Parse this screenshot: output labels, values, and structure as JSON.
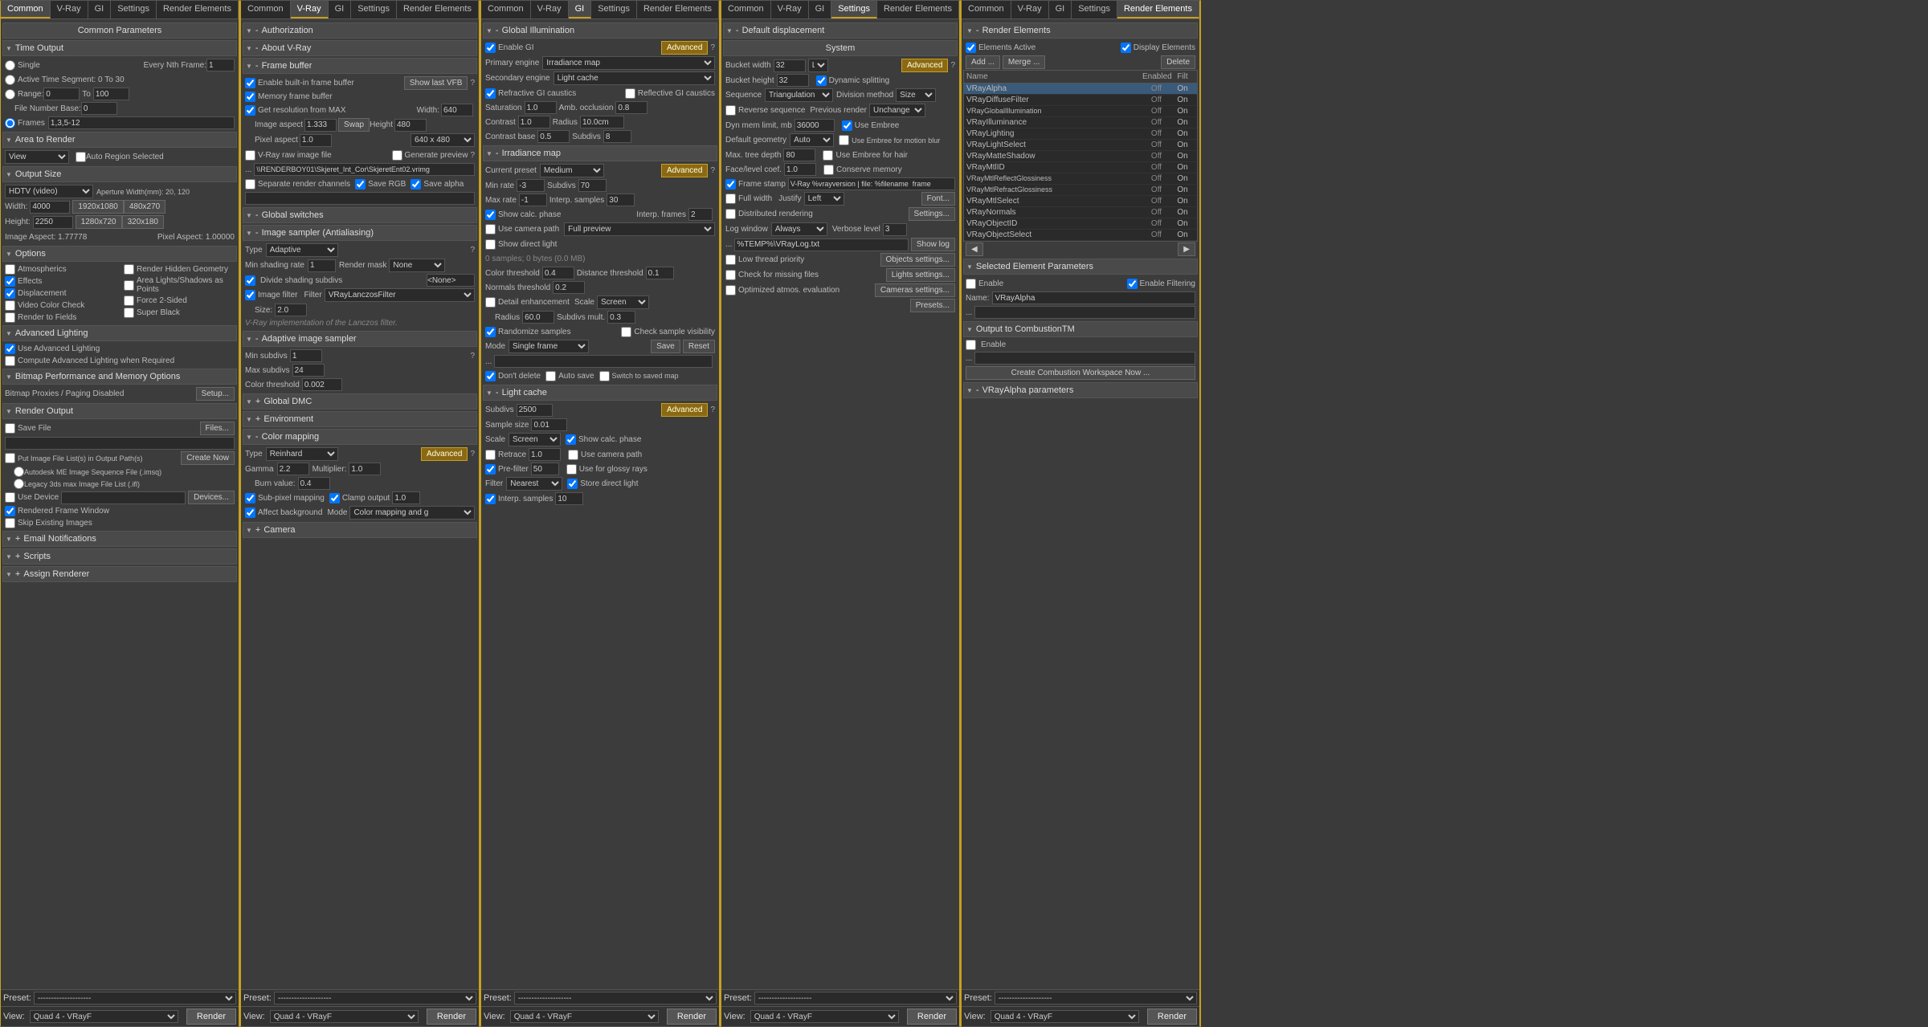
{
  "panels": [
    {
      "id": "panel1",
      "tabs": [
        "Common",
        "V-Ray",
        "GI",
        "Settings",
        "Render Elements"
      ],
      "activeTab": "Common",
      "title": "Common Parameters",
      "sections": {
        "timeOutput": {
          "label": "Time Output",
          "single": "Single",
          "everyNthFrame": "Every Nth Frame:",
          "activeTimeSegment": "Active Time Segment:",
          "range0": "0",
          "rangeTo": "To",
          "range100": "100",
          "fileNumberBase": "File Number Base:",
          "frames": "Frames",
          "framesVal": "1,3,5-12"
        },
        "areaToRender": {
          "label": "Area to Render",
          "view": "View",
          "autoRegionSelected": "Auto Region Selected"
        },
        "outputSize": {
          "label": "Output Size",
          "preset": "HDTV (video)",
          "apertureWidth": "Aperture Width(mm): 20, 120",
          "width": "Width:",
          "widthVal": "4000",
          "res1": "1920x1080",
          "res2": "480x270",
          "height": "Height:",
          "heightVal": "2250",
          "res3": "1280x720",
          "res4": "320x180",
          "imageAspect": "Image Aspect: 1.77778",
          "pixelAspect": "Pixel Aspect: 1.00000"
        },
        "options": {
          "label": "Options",
          "atmospherics": "Atmospherics",
          "renderHiddenGeometry": "Render Hidden Geometry",
          "effects": "Effects",
          "areaLights": "Area Lights/Shadows as Points",
          "displacement": "Displacement",
          "force2Sided": "Force 2-Sided",
          "videoColorCheck": "Video Color Check",
          "superBlack": "Super Black",
          "renderToFields": "Render to Fields"
        },
        "advancedLighting": {
          "label": "Advanced Lighting",
          "useAdvancedLighting": "Use Advanced Lighting",
          "computeAdvancedLighting": "Compute Advanced Lighting when Required"
        },
        "bitmapPerformance": {
          "label": "Bitmap Performance and Memory Options",
          "bitmapProxies": "Bitmap Proxies / Paging Disabled",
          "setup": "Setup..."
        },
        "renderOutput": {
          "label": "Render Output",
          "saveFile": "Save File",
          "files": "Files...",
          "putImageFile": "Put Image File List(s) in Output Path(s)",
          "createNow": "Create Now",
          "autodesk": "Autodesk ME Image Sequence File (.imsq)",
          "legacy": "Legacy 3ds max Image File List (.ifl)",
          "useDevice": "Use Device",
          "devices": "Devices...",
          "renderedFrameWindow": "Rendered Frame Window",
          "skipExistingImages": "Skip Existing Images"
        },
        "emailNotifications": "Email Notifications",
        "scripts": "Scripts",
        "assignRenderer": "Assign Renderer"
      }
    },
    {
      "id": "panel2",
      "tabs": [
        "Common",
        "V-Ray",
        "GI",
        "Settings",
        "Render Elements"
      ],
      "activeTab": "V-Ray",
      "sections": {
        "authorization": "Authorization",
        "aboutVRay": "About V-Ray",
        "frameBuffer": {
          "label": "Frame buffer",
          "enableBuiltIn": "Enable built-in frame buffer",
          "showLastVFB": "Show last VFB",
          "memoryFrameBuffer": "Memory frame buffer"
        },
        "getResFromMax": {
          "label": "Get resolution from MAX",
          "swap": "Swap",
          "width": "Width:",
          "widthVal": "640",
          "imageAspect": "Image aspect",
          "imageAspectVal": "1.333",
          "heightLabel": "Height",
          "heightVal": "480",
          "pixelAspect": "Pixel aspect",
          "pixelAspectVal": "1.0",
          "preset": "640 x 480"
        },
        "rawImageFile": {
          "vrayRaw": "V-Ray raw image file",
          "generatePreview": "Generate preview",
          "path": "\\\\RENDERBOY01\\Skjeret_Int_Cor\\SkjeretEnt02.vrimg",
          "separateRenderChannels": "Separate render channels",
          "saveRGB": "Save RGB",
          "saveAlpha": "Save alpha"
        },
        "globalSwitches": "Global switches",
        "imageSampler": {
          "label": "Image sampler (Antialiasing)",
          "type": "Type",
          "typeVal": "Adaptive",
          "minShadingRate": "Min shading rate",
          "minShadingRateVal": "1",
          "renderMask": "Render mask",
          "renderMaskVal": "None",
          "divideShadingSubdivs": "Divide shading subdivs",
          "noneVal": "<None>"
        },
        "imageFilter": {
          "imageFilter": "Image filter",
          "filter": "Filter",
          "filterVal": "VRayLanczosFilter",
          "size": "Size:",
          "sizeVal": "2.0",
          "description": "V-Ray implementation of the Lanczos filter."
        },
        "adaptiveImageSampler": {
          "label": "Adaptive image sampler",
          "minSubdivs": "Min subdivs",
          "minSubdivsVal": "1",
          "maxSubdivs": "Max subdivs",
          "maxSubdivsVal": "24",
          "colorThreshold": "Color threshold",
          "colorThresholdVal": "0.002"
        },
        "globalDMC": "Global DMC",
        "environment": "Environment",
        "colorMapping": {
          "label": "Color mapping",
          "type": "Type",
          "typeVal": "Reinhard",
          "advanced": "Advanced",
          "gamma": "Gamma",
          "gammaVal": "2.2",
          "multiplier": "Multiplier:",
          "multiplierVal": "1.0",
          "burnValue": "Burn value:",
          "burnValueVal": "0.4",
          "subPixelMapping": "Sub-pixel mapping",
          "clampOutput": "Clamp output",
          "clampVal": "1.0",
          "affectBackground": "Affect background",
          "mode": "Mode",
          "modeVal": "Color mapping and g"
        },
        "camera": "Camera"
      }
    },
    {
      "id": "panel3",
      "tabs": [
        "Common",
        "V-Ray",
        "GI",
        "Settings",
        "Render Elements"
      ],
      "activeTab": "GI",
      "sections": {
        "globalIllumination": {
          "label": "Global Illumination",
          "enableGI": "Enable GI",
          "advanced": "Advanced",
          "primaryEngine": "Primary engine",
          "primaryEngineVal": "Irradiance map",
          "secondaryEngine": "Secondary engine",
          "secondaryEngineVal": "Light cache",
          "refractiveGICaustics": "Refractive GI caustics",
          "reflectiveGICaustics": "Reflective GI caustics",
          "saturation": "Saturation",
          "saturationVal": "1.0",
          "ambOcclusion": "Amb. occlusion",
          "ambOcclusionVal": "0.8",
          "contrast": "Contrast",
          "contrastVal": "1.0",
          "radius": "Radius",
          "radiusVal": "10.0cm",
          "contrastBase": "Contrast base",
          "contrastBaseVal": "0.5",
          "subdivs": "Subdivs",
          "subdivsVal": "8"
        },
        "irradianceMap": {
          "label": "Irradiance map",
          "currentPreset": "Current preset",
          "currentPresetVal": "Medium",
          "advanced": "Advanced",
          "minRate": "Min rate",
          "minRateVal": "-3",
          "subdivs": "Subdivs",
          "subdivsVal": "70",
          "maxRate": "Max rate",
          "maxRateVal": "-1",
          "interpSamples": "Interp. samples",
          "interpSamplesVal": "30",
          "showCalcPhase": "Show calc. phase",
          "useCameraPath": "Use camera path",
          "fullPreview": "Full preview",
          "showDirectLight": "Show direct light",
          "interpFrames": "Interp. frames",
          "interpFramesVal": "2",
          "status": "0 samples; 0 bytes (0.0 MB)",
          "colorThreshold": "Color threshold",
          "colorThresholdVal": "0.4",
          "distanceThreshold": "Distance threshold",
          "distanceThresholdVal": "0.1",
          "normalsThreshold": "Normals threshold",
          "normalsThresholdVal": "0.2",
          "detailEnhancement": "Detail enhancement",
          "scale": "Scale",
          "scaleVal": "Screen",
          "radius": "Radius",
          "radiusVal": "60.0",
          "subdivsMult": "Subdivs mult.",
          "subdivsMultVal": "0.3",
          "randomizeSamples": "Randomize samples",
          "checkSampleVisibility": "Check sample visibility",
          "mode": "Mode",
          "modeVal": "Single frame",
          "save": "Save",
          "reset": "Reset",
          "dontDelete": "Don't delete",
          "autoSave": "Auto save",
          "switchToSavedMap": "Switch to saved map"
        },
        "lightCache": {
          "label": "Light cache",
          "subdivs": "Subdivs",
          "subdivsVal": "2500",
          "advanced": "Advanced",
          "sampleSize": "Sample size",
          "sampleSizeVal": "0.01",
          "scale": "Scale",
          "scaleVal": "Screen",
          "showCalcPhase": "Show calc. phase",
          "retrace": "Retrace",
          "retraceVal": "1.0",
          "useCameraPath": "Use camera path",
          "preFilter": "Pre-filter",
          "preFilterVal": "50",
          "useForGlossyRays": "Use for glossy rays",
          "filter": "Filter",
          "filterVal": "Nearest",
          "storeDirectLight": "Store direct light",
          "interpSamples": "Interp. samples",
          "interpSamplesVal": "10"
        }
      }
    },
    {
      "id": "panel4",
      "tabs": [
        "Common",
        "V-Ray",
        "GI",
        "Settings",
        "Render Elements"
      ],
      "activeTab": "Settings",
      "sections": {
        "defaultDisplacement": {
          "label": "Default displacement",
          "system": "System",
          "bucketWidth": "Bucket width",
          "bucketWidthVal": "32",
          "L": "L",
          "advanced": "Advanced",
          "bucketHeight": "Bucket height",
          "bucketHeightVal": "32",
          "dynamicSplitting": "Dynamic splitting",
          "sequence": "Sequence",
          "sequenceVal": "Triangulation",
          "divisionMethod": "Division method",
          "divisionMethodVal": "Size",
          "reverseSequence": "Reverse sequence",
          "previousRender": "Previous render",
          "previousRenderVal": "Unchange",
          "dynMemLimit": "Dyn mem limit, mb",
          "dynMemLimitVal": "36000",
          "useEmbree": "Use Embree",
          "defaultGeometry": "Default geometry",
          "defaultGeometryVal": "Auto",
          "useEmbreeForMotionBlur": "Use Embree for motion blur",
          "maxTreeDepth": "Max. tree depth",
          "maxTreeDepthVal": "80",
          "useEmbreeForHair": "Use Embree for hair",
          "faceLevelCoef": "Face/level coef.",
          "faceLevelCoefVal": "1.0",
          "conserveMemory": "Conserve memory",
          "frameStamp": "Frame stamp",
          "frameStampVal": "V-Ray %vrayversion | file: %filename  frame",
          "fullWidth": "Full width",
          "justify": "Justify",
          "justifyVal": "Left",
          "font": "Font...",
          "distributedRendering": "Distributed rendering",
          "settings": "Settings...",
          "logWindow": "Log window",
          "logWindowVal": "Always",
          "verboseLevel": "Verbose level",
          "verboseLevelVal": "3",
          "showLog": "Show log",
          "logPath": "%TEMP%\\VRayLog.txt",
          "lowThreadPriority": "Low thread priority",
          "objectsSettings": "Objects settings...",
          "checkForMissingFiles": "Check for missing files",
          "lightsSettings": "Lights settings...",
          "optimizedAtmosEval": "Optimized atmos. evaluation",
          "camerasSettings": "Cameras settings...",
          "presets": "Presets..."
        }
      }
    },
    {
      "id": "panel5",
      "tabs": [
        "Common",
        "V-Ray",
        "GI",
        "Settings",
        "Render Elements"
      ],
      "activeTab": "Render Elements",
      "sections": {
        "renderElements": {
          "label": "Render Elements",
          "elementsActive": "Elements Active",
          "displayElements": "Display Elements",
          "add": "Add ...",
          "merge": "Merge ...",
          "delete": "Delete",
          "columns": [
            "Name",
            "Enabled",
            "Filt"
          ],
          "items": [
            {
              "name": "VRayAlpha",
              "enabled": "Off",
              "filter": "On",
              "selected": true
            },
            {
              "name": "VRayDiffuseFilter",
              "enabled": "Off",
              "filter": "On"
            },
            {
              "name": "VRayGlobalIllumination",
              "enabled": "Off",
              "filter": "On"
            },
            {
              "name": "VRayIlluminance",
              "enabled": "Off",
              "filter": "On"
            },
            {
              "name": "VRayLighting",
              "enabled": "Off",
              "filter": "On"
            },
            {
              "name": "VRayLightSelect",
              "enabled": "Off",
              "filter": "On"
            },
            {
              "name": "VRayMatteShadow",
              "enabled": "Off",
              "filter": "On"
            },
            {
              "name": "VRayMtlID",
              "enabled": "Off",
              "filter": "On"
            },
            {
              "name": "VRayMtlReflectGlossiness",
              "enabled": "Off",
              "filter": "On"
            },
            {
              "name": "VRayMtlRefractGlossiness",
              "enabled": "Off",
              "filter": "On"
            },
            {
              "name": "VRayMtlSelect",
              "enabled": "Off",
              "filter": "On"
            },
            {
              "name": "VRayNormals",
              "enabled": "Off",
              "filter": "On"
            },
            {
              "name": "VRayObjectID",
              "enabled": "Off",
              "filter": "On"
            },
            {
              "name": "VRayObjectSelect",
              "enabled": "Off",
              "filter": "On"
            }
          ]
        },
        "selectedElementParameters": {
          "label": "Selected Element Parameters",
          "enable": "Enable",
          "enableFiltering": "Enable Filtering",
          "name": "Name:",
          "nameVal": "VRayAlpha"
        },
        "outputToCombustion": {
          "label": "Output to CombustionTM",
          "enable": "Enable"
        },
        "vrayAlphaParameters": "VRayAlpha parameters"
      }
    }
  ],
  "footer": {
    "preset": "--------------------",
    "view": "Quad 4 - VRayF",
    "render": "Render"
  }
}
